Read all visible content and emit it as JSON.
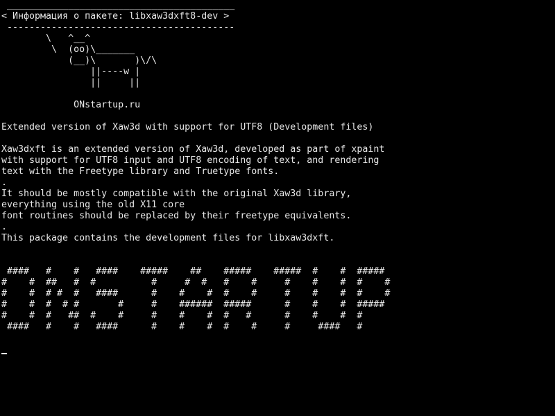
{
  "colors": {
    "background": "#000000",
    "foreground": "#e8e8e8"
  },
  "bubble": {
    "top_border": " _________________________________________",
    "title": "< Информация о пакете: libxaw3dxft8-dev >",
    "bottom_border": " -----------------------------------------"
  },
  "cow": [
    "        \\   ^__^",
    "         \\  (oo)\\_______",
    "            (__)\\       )\\/\\",
    "                ||----w |",
    "                ||     ||"
  ],
  "site": "             ONstartup.ru",
  "package": {
    "summary": "Extended version of Xaw3d with support for UTF8 (Development files)",
    "description": [
      "Xaw3dxft is an extended version of Xaw3d, developed as part of xpaint",
      "with support for UTF8 input and UTF8 encoding of text, and rendering",
      "text with the Freetype library and Truetype fonts.",
      ".",
      "It should be mostly compatible with the original Xaw3d library,",
      "everything using the old X11 core",
      "font routines should be replaced by their freetype equivalents.",
      ".",
      "This package contains the development files for libxaw3dxft."
    ]
  },
  "banner": [
    " ####   #    #   ####    #####    ##    #####    #####  #    #  #####",
    "#    #  ##   #  #          #     #  #   #    #     #    #    #  #    #",
    "#    #  # #  #   ####      #    #    #  #    #     #    #    #  #    #",
    "#    #  #  # #       #     #    ######  #####      #    #    #  #####",
    "#    #  #   ##  #    #     #    #    #  #   #      #    #    #  #",
    " ####   #    #   ####      #    #    #  #    #     #     ####   #"
  ]
}
